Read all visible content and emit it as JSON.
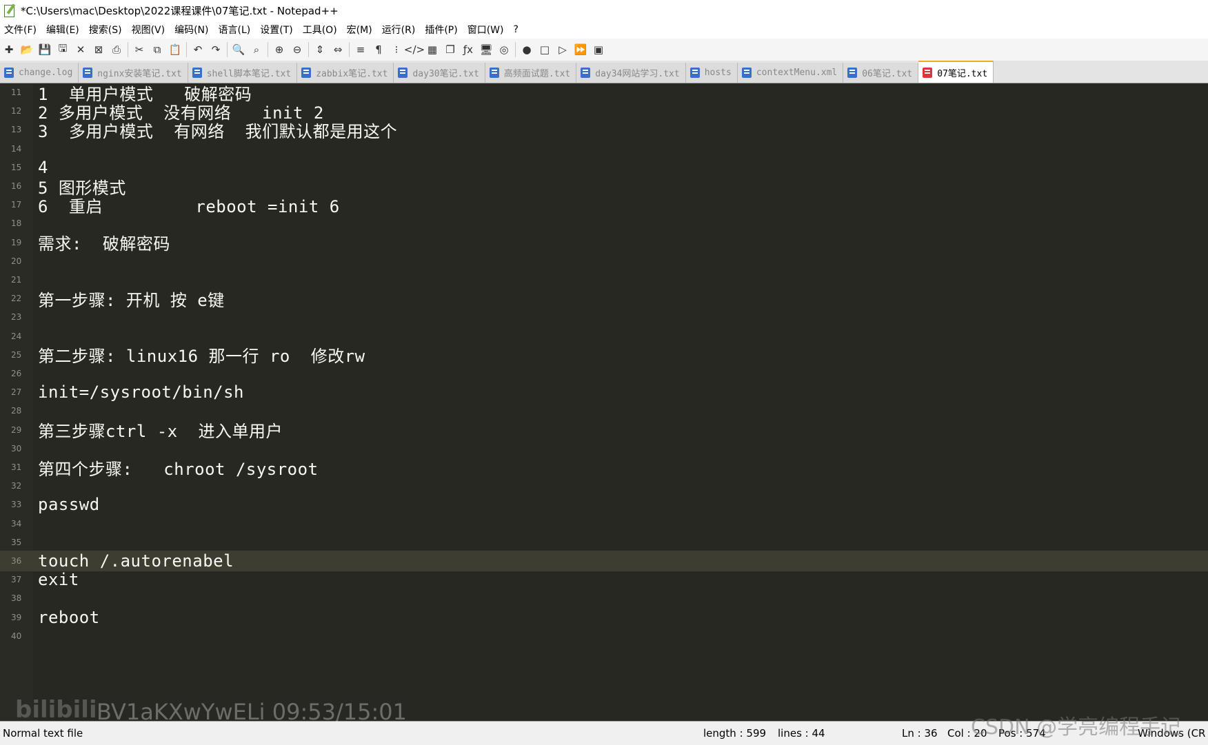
{
  "window": {
    "title": "*C:\\Users\\mac\\Desktop\\2022课程课件\\07笔记.txt - Notepad++"
  },
  "menu": [
    "文件(F)",
    "编辑(E)",
    "搜索(S)",
    "视图(V)",
    "编码(N)",
    "语言(L)",
    "设置(T)",
    "工具(O)",
    "宏(M)",
    "运行(R)",
    "插件(P)",
    "窗口(W)",
    "?"
  ],
  "toolbar": {
    "icons": [
      "new-file-icon",
      "open-file-icon",
      "save-icon",
      "save-all-icon",
      "close-icon",
      "close-all-icon",
      "print-icon",
      "cut-icon",
      "copy-icon",
      "paste-icon",
      "undo-icon",
      "redo-icon",
      "find-icon",
      "replace-icon",
      "zoom-in-icon",
      "zoom-out-icon",
      "sync-vertical-icon",
      "sync-horizontal-icon",
      "word-wrap-icon",
      "show-all-chars-icon",
      "indent-guide-icon",
      "xml-tag-icon",
      "document-map-icon",
      "doc-list-icon",
      "function-list-icon",
      "monitor-icon",
      "folder-workspace-icon",
      "record-macro-icon",
      "stop-record-icon",
      "play-macro-icon",
      "run-macro-multiple-icon",
      "save-macro-icon"
    ],
    "glyphs": [
      "✚",
      "📂",
      "💾",
      "🖫",
      "✕",
      "⊠",
      "⎙",
      "✂",
      "⧉",
      "📋",
      "↶",
      "↷",
      "🔍",
      "⌕",
      "⊕",
      "⊖",
      "⇕",
      "⇔",
      "≡",
      "¶",
      "⁝",
      "</>",
      "▦",
      "❐",
      "ƒx",
      "🖥",
      "◎",
      "●",
      "□",
      "▷",
      "⏩",
      "▣"
    ]
  },
  "tabs": [
    {
      "label": "change.log",
      "active": false
    },
    {
      "label": "nginx安装笔记.txt",
      "active": false
    },
    {
      "label": "shell脚本笔记.txt",
      "active": false
    },
    {
      "label": "zabbix笔记.txt",
      "active": false
    },
    {
      "label": "day30笔记.txt",
      "active": false
    },
    {
      "label": "高频面试题.txt",
      "active": false
    },
    {
      "label": "day34网站学习.txt",
      "active": false
    },
    {
      "label": "hosts",
      "active": false
    },
    {
      "label": "contextMenu.xml",
      "active": false
    },
    {
      "label": "06笔记.txt",
      "active": false
    },
    {
      "label": "07笔记.txt",
      "active": true
    }
  ],
  "editor": {
    "current_line": 36,
    "lines": [
      {
        "n": "11",
        "text": "1  单用户模式   破解密码"
      },
      {
        "n": "12",
        "text": "2 多用户模式  没有网络   init 2"
      },
      {
        "n": "13",
        "text": "3  多用户模式  有网络  我们默认都是用这个"
      },
      {
        "n": "14",
        "text": ""
      },
      {
        "n": "15",
        "text": "4"
      },
      {
        "n": "16",
        "text": "5 图形模式"
      },
      {
        "n": "17",
        "text": "6  重启         reboot =init 6"
      },
      {
        "n": "18",
        "text": ""
      },
      {
        "n": "19",
        "text": "需求:  破解密码"
      },
      {
        "n": "20",
        "text": ""
      },
      {
        "n": "21",
        "text": ""
      },
      {
        "n": "22",
        "text": "第一步骤: 开机 按 e键"
      },
      {
        "n": "23",
        "text": ""
      },
      {
        "n": "24",
        "text": ""
      },
      {
        "n": "25",
        "text": "第二步骤: linux16 那一行 ro  修改rw"
      },
      {
        "n": "26",
        "text": ""
      },
      {
        "n": "27",
        "text": "init=/sysroot/bin/sh"
      },
      {
        "n": "28",
        "text": ""
      },
      {
        "n": "29",
        "text": "第三步骤ctrl -x  进入单用户"
      },
      {
        "n": "30",
        "text": ""
      },
      {
        "n": "31",
        "text": "第四个步骤:   chroot /sysroot"
      },
      {
        "n": "32",
        "text": ""
      },
      {
        "n": "33",
        "text": "passwd"
      },
      {
        "n": "34",
        "text": ""
      },
      {
        "n": "35",
        "text": ""
      },
      {
        "n": "36",
        "text": "touch /.autorenabel"
      },
      {
        "n": "37",
        "text": "exit"
      },
      {
        "n": "38",
        "text": ""
      },
      {
        "n": "39",
        "text": "reboot"
      },
      {
        "n": "40",
        "text": ""
      }
    ]
  },
  "status": {
    "file_type": "Normal text file",
    "length": "length : 599",
    "lines": "lines : 44",
    "ln": "Ln : 36",
    "col": "Col : 20",
    "pos": "Pos : 574",
    "eol": "Windows (CR"
  },
  "watermarks": {
    "bilibili_id": "BV1aKXwYwELi 09:53/15:01",
    "csdn": "CSDN @学亮编程手记"
  },
  "colors": {
    "editor_bg": "#272822",
    "text": "#f8f8f2",
    "current_line_bg": "#3e3d32",
    "active_tab_accent": "#f5a623"
  }
}
